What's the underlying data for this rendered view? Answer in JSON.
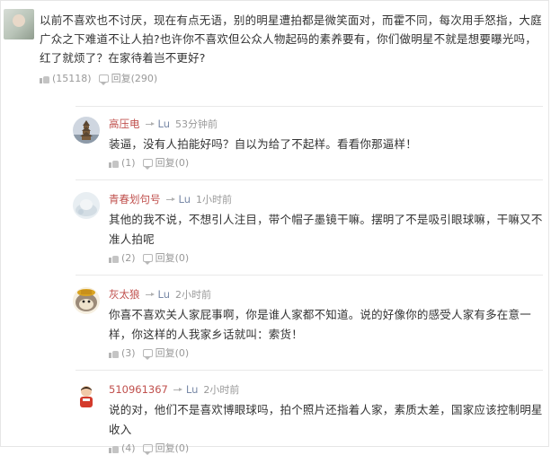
{
  "top_comment": {
    "text": "以前不喜欢也不讨厌，现在有点无语，别的明星遭拍都是微笑面对，而霍不同，每次用手怒指，大庭广众之下难道不让人拍?也许你不喜欢但公众人物起码的素养要有，你们做明星不就是想要曝光吗，红了就烦了？在家待着岂不更好?",
    "likes": "(15118)",
    "reply_label": "回复(290)"
  },
  "replies": [
    {
      "user": "高压电",
      "target": "Lu",
      "time": "53分钟前",
      "text": "装逼，没有人拍能好吗？自以为给了不起样。看看你那逼样！",
      "likes": "(1)",
      "reply_label": "回复(0)"
    },
    {
      "user": "青春划句号",
      "target": "Lu",
      "time": "1小时前",
      "text": "其他的我不说，不想引人注目，带个帽子墨镜干嘛。摆明了不是吸引眼球嘛，干嘛又不准人拍呢",
      "likes": "(2)",
      "reply_label": "回复(0)"
    },
    {
      "user": "灰太狼",
      "target": "Lu",
      "time": "2小时前",
      "text": "你喜不喜欢关人家屁事啊，你是谁人家都不知道。说的好像你的感受人家有多在意一样，你这样的人我家乡话就叫：索货！",
      "likes": "(3)",
      "reply_label": "回复(0)"
    },
    {
      "user": "510961367",
      "target": "Lu",
      "time": "2小时前",
      "text": "说的对，他们不是喜欢博眼球吗，拍个照片还指着人家，素质太差，国家应该控制明星收入",
      "likes": "(4)",
      "reply_label": "回复(0)"
    }
  ],
  "icons": {
    "like": "thumbs-up-icon",
    "reply": "comment-icon",
    "reply_arrow": "arrow-right-icon"
  },
  "colors": {
    "username": "#c0504d",
    "target": "#7a8aa8",
    "muted": "#999999",
    "text": "#333333"
  }
}
